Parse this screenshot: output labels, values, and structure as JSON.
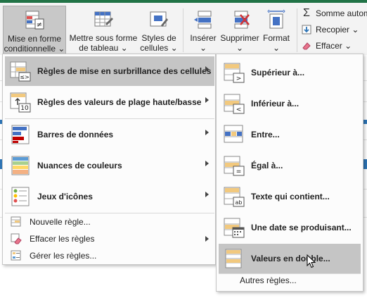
{
  "ribbon": {
    "buttons": [
      {
        "line1": "Mise en forme",
        "line2": "conditionnelle ⌄"
      },
      {
        "line1": "Mettre sous forme",
        "line2": "de tableau ⌄"
      },
      {
        "line1": "Styles de",
        "line2": "cellules ⌄"
      },
      {
        "line1": "Insérer",
        "line2": "⌄"
      },
      {
        "line1": "Supprimer",
        "line2": "⌄"
      },
      {
        "line1": "Format",
        "line2": "⌄"
      }
    ],
    "editing": [
      {
        "label": "Somme autom",
        "icon": "sigma-icon"
      },
      {
        "label": "Recopier ⌄",
        "icon": "fill-down-icon"
      },
      {
        "label": "Effacer ⌄",
        "icon": "eraser-icon"
      }
    ]
  },
  "menu": {
    "items": [
      {
        "label": "Règles de mise en surbrillance des cellules",
        "icon": "highlight-cells-rules-icon"
      },
      {
        "label": "Règles des valeurs de plage haute/basse",
        "icon": "top-bottom-rules-icon"
      },
      {
        "label": "Barres de données",
        "icon": "data-bars-icon"
      },
      {
        "label": "Nuances de couleurs",
        "icon": "color-scales-icon"
      },
      {
        "label": "Jeux d'icônes",
        "icon": "icon-sets-icon"
      }
    ],
    "small_items": [
      {
        "label": "Nouvelle règle...",
        "icon": "new-rule-icon"
      },
      {
        "label": "Effacer les règles",
        "icon": "clear-rules-icon"
      },
      {
        "label": "Gérer les règles...",
        "icon": "manage-rules-icon"
      }
    ],
    "big_icon_texts": {
      "highlight": "≤>",
      "topbottom": "10"
    }
  },
  "submenu": {
    "items": [
      {
        "label": "Supérieur à...",
        "icon": "greater-than-icon",
        "glyph": ">"
      },
      {
        "label": "Inférieur à...",
        "icon": "less-than-icon",
        "glyph": "<"
      },
      {
        "label": "Entre...",
        "icon": "between-icon",
        "glyph": ""
      },
      {
        "label": "Égal à...",
        "icon": "equal-to-icon",
        "glyph": "="
      },
      {
        "label": "Texte qui contient...",
        "icon": "text-contains-icon",
        "glyph": "ab"
      },
      {
        "label": "Une date se produisant...",
        "icon": "date-occurring-icon",
        "glyph": ""
      },
      {
        "label": "Valeurs en double...",
        "icon": "duplicate-values-icon",
        "glyph": ""
      }
    ],
    "more_rules": "Autres règles..."
  },
  "colors": {
    "accent": "#217346",
    "highlight": "#c5c5c5",
    "cell_fill": "#f2c97e",
    "blue": "#2e75b6"
  }
}
